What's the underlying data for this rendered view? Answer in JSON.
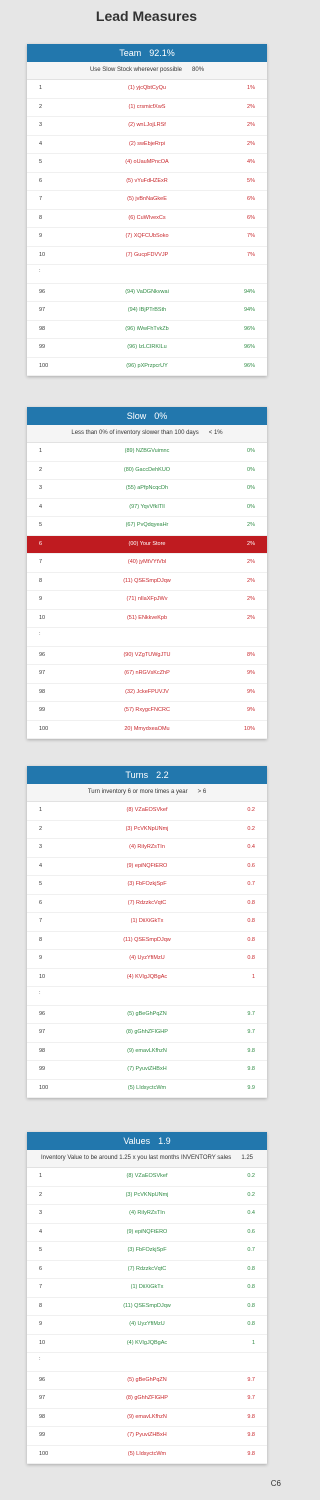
{
  "page_title": "Lead Measures",
  "corner_label": "C6",
  "cards": [
    {
      "title": "Team",
      "score": "92.1%",
      "subtitle": "Use Slow Stock wherever possible",
      "goal": "80%",
      "rows": [
        {
          "rank": "1",
          "name": "(1) yjcQbtCyQu",
          "value": "1%",
          "color": "red"
        },
        {
          "rank": "2",
          "name": "(1) crsmicfXwS",
          "value": "2%",
          "color": "red"
        },
        {
          "rank": "3",
          "name": "(2) wnLJojLRSf",
          "value": "2%",
          "color": "red"
        },
        {
          "rank": "4",
          "name": "(2) swEbjeRrpi",
          "value": "2%",
          "color": "red"
        },
        {
          "rank": "5",
          "name": "(4) oUauMPncOA",
          "value": "4%",
          "color": "red"
        },
        {
          "rank": "6",
          "name": "(5) vYuFdHZExR",
          "value": "5%",
          "color": "red"
        },
        {
          "rank": "7",
          "name": "(5) jvBnNaGkeE",
          "value": "6%",
          "color": "red"
        },
        {
          "rank": "8",
          "name": "(6) CuWIvexCs",
          "value": "6%",
          "color": "red"
        },
        {
          "rank": "9",
          "name": "(7) XQFCUbSoko",
          "value": "7%",
          "color": "red"
        },
        {
          "rank": "10",
          "name": "(7) GucpFDVVJP",
          "value": "7%",
          "color": "red"
        },
        {
          "rank": ":",
          "name": "",
          "value": "",
          "color": "none"
        },
        {
          "rank": "96",
          "name": "(94) VaDGNkvwai",
          "value": "94%",
          "color": "green"
        },
        {
          "rank": "97",
          "name": "(94) IBjPTrBSth",
          "value": "94%",
          "color": "green"
        },
        {
          "rank": "98",
          "name": "(96) iWwFhTvkZb",
          "value": "96%",
          "color": "green"
        },
        {
          "rank": "99",
          "name": "(96) IzLCIRKILu",
          "value": "96%",
          "color": "green"
        },
        {
          "rank": "100",
          "name": "(96) pXPrzpcrUY",
          "value": "96%",
          "color": "green"
        }
      ]
    },
    {
      "title": "Slow",
      "score": "0%",
      "subtitle": "Less than 0% of inventory slower than 100 days",
      "goal": "< 1%",
      "rows": [
        {
          "rank": "1",
          "name": "(89) NZBGVuimnc",
          "value": "0%",
          "color": "green"
        },
        {
          "rank": "2",
          "name": "(80) GaccDehKUO",
          "value": "0%",
          "color": "green"
        },
        {
          "rank": "3",
          "name": "(55) aPfpNcqcDh",
          "value": "0%",
          "color": "green"
        },
        {
          "rank": "4",
          "name": "(97) YqvVfkITll",
          "value": "0%",
          "color": "green"
        },
        {
          "rank": "5",
          "name": "(67) PvQdqyeaHr",
          "value": "2%",
          "color": "green"
        },
        {
          "rank": "6",
          "name": "(00) Your Store",
          "value": "2%",
          "color": "highlight"
        },
        {
          "rank": "7",
          "name": "(40) jyMtVYtVbl",
          "value": "2%",
          "color": "red"
        },
        {
          "rank": "8",
          "name": "(11) QSESmpDJqw",
          "value": "2%",
          "color": "red"
        },
        {
          "rank": "9",
          "name": "(71) nIlaXFpJWv",
          "value": "2%",
          "color": "red"
        },
        {
          "rank": "10",
          "name": "(51) ENkkveKpb",
          "value": "2%",
          "color": "red"
        },
        {
          "rank": ":",
          "name": "",
          "value": "",
          "color": "none"
        },
        {
          "rank": "96",
          "name": "(90) VZgTUWgJTU",
          "value": "8%",
          "color": "red"
        },
        {
          "rank": "97",
          "name": "(67) nRGVsKcZhP",
          "value": "9%",
          "color": "red"
        },
        {
          "rank": "98",
          "name": "(32) JckeFPUVJV",
          "value": "9%",
          "color": "red"
        },
        {
          "rank": "99",
          "name": "(57) RxygcFNCRC",
          "value": "9%",
          "color": "red"
        },
        {
          "rank": "100",
          "name": "20) MmydxeaOMu",
          "value": "10%",
          "color": "red"
        }
      ]
    },
    {
      "title": "Turns",
      "score": "2.2",
      "subtitle": "Turn inventory 6 or more times a year",
      "goal": "> 6",
      "rows": [
        {
          "rank": "1",
          "name": "(8) VZaEOSVkef",
          "value": "0.2",
          "color": "red"
        },
        {
          "rank": "2",
          "name": "(3) PcVKNpUNmj",
          "value": "0.2",
          "color": "red"
        },
        {
          "rank": "3",
          "name": "(4) RiIyRZsTIn",
          "value": "0.4",
          "color": "red"
        },
        {
          "rank": "4",
          "name": "(9) epiNQFtERO",
          "value": "0.6",
          "color": "red"
        },
        {
          "rank": "5",
          "name": "(3) FbFOzkjSpF",
          "value": "0.7",
          "color": "red"
        },
        {
          "rank": "6",
          "name": "(7) RdzzkcVqtC",
          "value": "0.8",
          "color": "red"
        },
        {
          "rank": "7",
          "name": "(1) DiiXiGkTx",
          "value": "0.8",
          "color": "red"
        },
        {
          "rank": "8",
          "name": "(11) QSESmpDJqw",
          "value": "0.8",
          "color": "red"
        },
        {
          "rank": "9",
          "name": "(4) UyzYfiMzU",
          "value": "0.8",
          "color": "red"
        },
        {
          "rank": "10",
          "name": "(4) KVIgJQBgAc",
          "value": "1",
          "color": "red"
        },
        {
          "rank": ":",
          "name": "",
          "value": "",
          "color": "none"
        },
        {
          "rank": "96",
          "name": "(5) gBeGhPqZN",
          "value": "9.7",
          "color": "green"
        },
        {
          "rank": "97",
          "name": "(8) gGhhZFIGHP",
          "value": "9.7",
          "color": "green"
        },
        {
          "rank": "98",
          "name": "(9) emavLKfhzN",
          "value": "9.8",
          "color": "green"
        },
        {
          "rank": "99",
          "name": "(7) PyuviZHBxH",
          "value": "9.8",
          "color": "green"
        },
        {
          "rank": "100",
          "name": "(5) LIdsyctcWm",
          "value": "9.9",
          "color": "green"
        }
      ]
    },
    {
      "title": "Values",
      "score": "1.9",
      "subtitle": "Inventory Value to be around 1.25 x you last months INVENTORY sales",
      "goal": "1.25",
      "rows": [
        {
          "rank": "1",
          "name": "(8) VZaEOSVkef",
          "value": "0.2",
          "color": "green"
        },
        {
          "rank": "2",
          "name": "(3) PcVKNpUNmj",
          "value": "0.2",
          "color": "green"
        },
        {
          "rank": "3",
          "name": "(4) RiIyRZsTIn",
          "value": "0.4",
          "color": "green"
        },
        {
          "rank": "4",
          "name": "(9) epiNQFtERO",
          "value": "0.6",
          "color": "green"
        },
        {
          "rank": "5",
          "name": "(3) FbFOzkjSpF",
          "value": "0.7",
          "color": "green"
        },
        {
          "rank": "6",
          "name": "(7) RdzzkcVqtC",
          "value": "0.8",
          "color": "green"
        },
        {
          "rank": "7",
          "name": "(1) DiiXiGkTx",
          "value": "0.8",
          "color": "green"
        },
        {
          "rank": "8",
          "name": "(11) QSESmpDJqw",
          "value": "0.8",
          "color": "green"
        },
        {
          "rank": "9",
          "name": "(4) UyzYfiMzU",
          "value": "0.8",
          "color": "green"
        },
        {
          "rank": "10",
          "name": "(4) KVIgJQBgAc",
          "value": "1",
          "color": "green"
        },
        {
          "rank": ":",
          "name": "",
          "value": "",
          "color": "none"
        },
        {
          "rank": "96",
          "name": "(5) gBeGhPqZN",
          "value": "9.7",
          "color": "red"
        },
        {
          "rank": "97",
          "name": "(8) gGhhZFIGHP",
          "value": "9.7",
          "color": "red"
        },
        {
          "rank": "98",
          "name": "(9) emavLKfhzN",
          "value": "9.8",
          "color": "red"
        },
        {
          "rank": "99",
          "name": "(7) PyuviZHBxH",
          "value": "9.8",
          "color": "red"
        },
        {
          "rank": "100",
          "name": "(5) LIdsyctcWm",
          "value": "9.8",
          "color": "red"
        }
      ]
    }
  ]
}
